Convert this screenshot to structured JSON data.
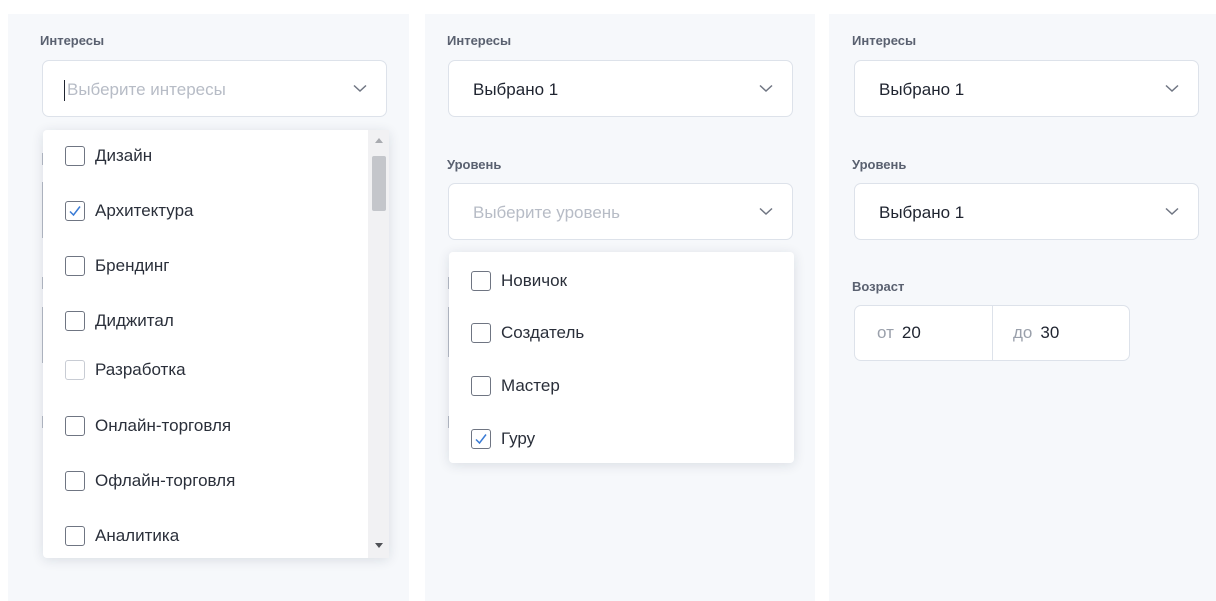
{
  "panel1": {
    "interests": {
      "label": "Интересы",
      "placeholder": "Выберите интересы",
      "options": [
        {
          "label": "Дизайн",
          "checked": false
        },
        {
          "label": "Архитектура",
          "checked": true
        },
        {
          "label": "Брендинг",
          "checked": false
        },
        {
          "label": "Диджитал",
          "checked": false
        },
        {
          "label": "Разработка",
          "checked": false
        },
        {
          "label": "Онлайн-торговля",
          "checked": false
        },
        {
          "label": "Офлайн-торговля",
          "checked": false
        },
        {
          "label": "Аналитика",
          "checked": false
        }
      ]
    }
  },
  "panel2": {
    "interests": {
      "label": "Интересы",
      "value": "Выбрано 1"
    },
    "level": {
      "label": "Уровень",
      "placeholder": "Выберите уровень",
      "options": [
        {
          "label": "Новичок",
          "checked": false
        },
        {
          "label": "Создатель",
          "checked": false
        },
        {
          "label": "Мастер",
          "checked": false
        },
        {
          "label": "Гуру",
          "checked": true
        }
      ]
    }
  },
  "panel3": {
    "interests": {
      "label": "Интересы",
      "value": "Выбрано 1"
    },
    "level": {
      "label": "Уровень",
      "value": "Выбрано 1"
    },
    "age": {
      "label": "Возраст",
      "from_prefix": "от",
      "from_value": "20",
      "to_prefix": "до",
      "to_value": "30"
    }
  },
  "colors": {
    "check": "#3a7bd5",
    "checkbox_border": "#6f7582",
    "panel_bg": "#f6f8fb"
  }
}
